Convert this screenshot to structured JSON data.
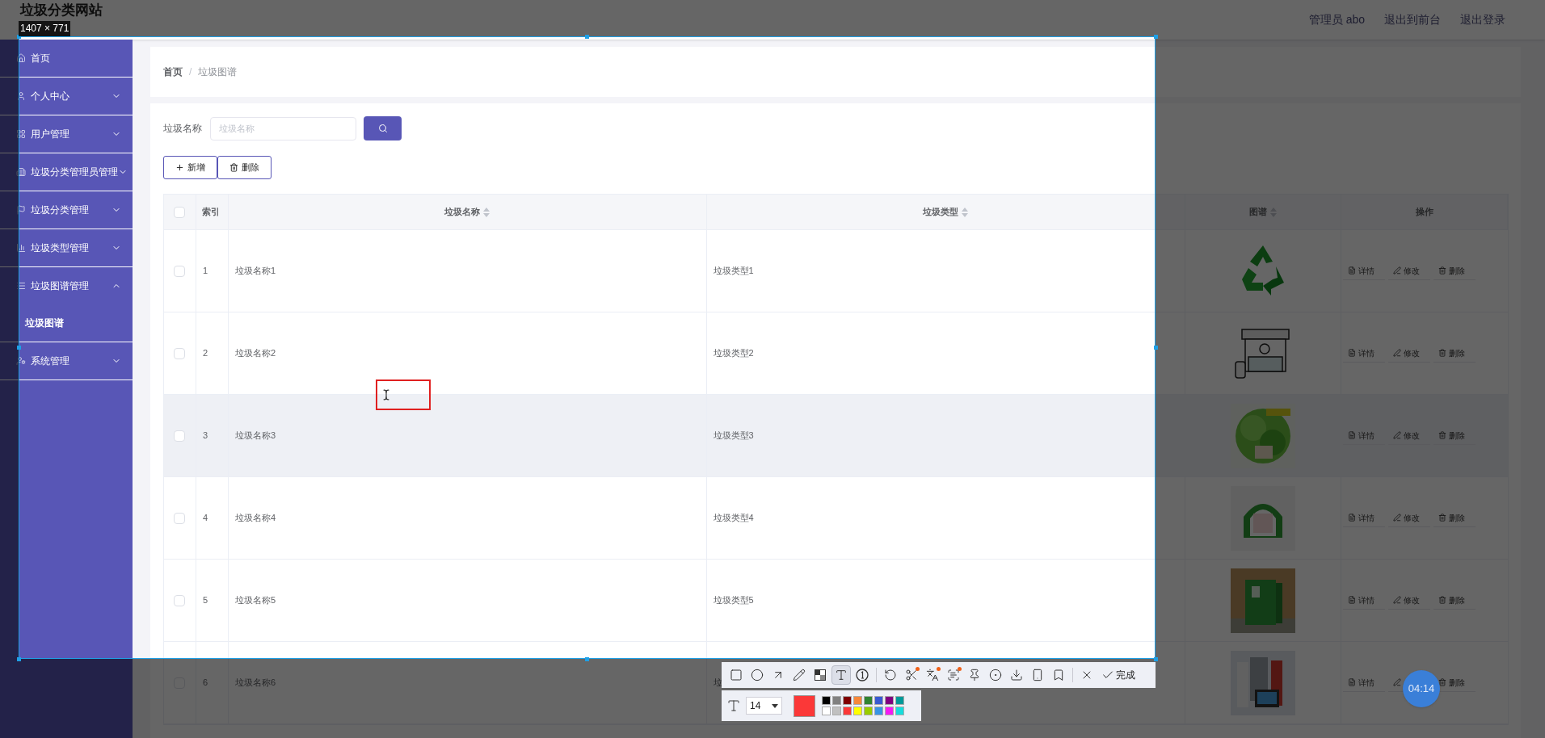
{
  "header": {
    "title": "垃圾分类网站",
    "user": "管理员 abo",
    "links": [
      "退出到前台",
      "退出登录"
    ]
  },
  "sidebar": {
    "items": [
      {
        "label": "首页",
        "kind": "link"
      },
      {
        "label": "个人中心",
        "kind": "menu",
        "expanded": false
      },
      {
        "label": "用户管理",
        "kind": "menu",
        "expanded": false
      },
      {
        "label": "垃圾分类管理员管理",
        "kind": "menu",
        "expanded": false
      },
      {
        "label": "垃圾分类管理",
        "kind": "menu",
        "expanded": false
      },
      {
        "label": "垃圾类型管理",
        "kind": "menu",
        "expanded": false
      },
      {
        "label": "垃圾图谱管理",
        "kind": "menu",
        "expanded": true,
        "children": [
          {
            "label": "垃圾图谱"
          }
        ]
      },
      {
        "label": "系统管理",
        "kind": "menu",
        "expanded": false
      }
    ]
  },
  "breadcrumb": {
    "items": [
      "首页",
      "垃圾图谱"
    ],
    "separator": "/"
  },
  "search": {
    "label": "垃圾名称",
    "placeholder": "垃圾名称"
  },
  "buttons": [
    {
      "kind": "add",
      "label": "新增"
    },
    {
      "kind": "delete",
      "label": "删除"
    }
  ],
  "table": {
    "header_checked": false,
    "columns": [
      {
        "label": "索引",
        "sortable": false
      },
      {
        "label": "垃圾名称",
        "sortable": true
      },
      {
        "label": "垃圾类型",
        "sortable": true
      },
      {
        "label": "图谱",
        "sortable": true
      },
      {
        "label": "操作",
        "sortable": false
      }
    ],
    "rows": [
      {
        "checked": false,
        "hovered": false,
        "index": "1",
        "name": "垃圾名称1",
        "type": "垃圾类型1",
        "actions": [
          {
            "kind": "detail",
            "label": "详情"
          },
          {
            "kind": "edit",
            "label": "修改"
          },
          {
            "kind": "delete",
            "label": "删除"
          }
        ]
      },
      {
        "checked": false,
        "hovered": false,
        "index": "2",
        "name": "垃圾名称2",
        "type": "垃圾类型2",
        "actions": [
          {
            "kind": "detail",
            "label": "详情"
          },
          {
            "kind": "edit",
            "label": "修改"
          },
          {
            "kind": "delete",
            "label": "删除"
          }
        ]
      },
      {
        "checked": false,
        "hovered": true,
        "index": "3",
        "name": "垃圾名称3",
        "type": "垃圾类型3",
        "actions": [
          {
            "kind": "detail",
            "label": "详情"
          },
          {
            "kind": "edit",
            "label": "修改"
          },
          {
            "kind": "delete",
            "label": "删除"
          }
        ]
      },
      {
        "checked": false,
        "hovered": false,
        "index": "4",
        "name": "垃圾名称4",
        "type": "垃圾类型4",
        "actions": [
          {
            "kind": "detail",
            "label": "详情"
          },
          {
            "kind": "edit",
            "label": "修改"
          },
          {
            "kind": "delete",
            "label": "删除"
          }
        ]
      },
      {
        "checked": false,
        "hovered": false,
        "index": "5",
        "name": "垃圾名称5",
        "type": "垃圾类型5",
        "actions": [
          {
            "kind": "detail",
            "label": "详情"
          },
          {
            "kind": "edit",
            "label": "修改"
          },
          {
            "kind": "delete",
            "label": "删除"
          }
        ]
      },
      {
        "checked": false,
        "hovered": false,
        "index": "6",
        "name": "垃圾名称6",
        "type": "垃",
        "actions": [
          {
            "kind": "detail",
            "label": "详情"
          },
          {
            "kind": "edit"
          },
          {
            "kind": "delete",
            "label": "删除"
          }
        ]
      }
    ]
  },
  "capture": {
    "size_label": "1407 × 771",
    "tool_groups": [
      [
        {
          "kind": "rect",
          "selected": false,
          "badge": false
        },
        {
          "kind": "ellipse",
          "selected": false,
          "badge": false
        },
        {
          "kind": "arrow",
          "selected": false,
          "badge": false
        },
        {
          "kind": "pen",
          "selected": false,
          "badge": false
        },
        {
          "kind": "mosaic",
          "selected": false,
          "badge": false
        },
        {
          "kind": "text",
          "selected": true,
          "badge": false
        },
        {
          "kind": "number",
          "selected": false,
          "badge": false
        }
      ],
      [
        {
          "kind": "undo",
          "selected": false,
          "badge": false
        },
        {
          "kind": "cut",
          "selected": false,
          "badge": true
        },
        {
          "kind": "translate",
          "selected": false,
          "badge": true
        },
        {
          "kind": "ocr",
          "selected": false,
          "badge": true
        },
        {
          "kind": "pin",
          "selected": false,
          "badge": false
        },
        {
          "kind": "record",
          "selected": false,
          "badge": false
        },
        {
          "kind": "save",
          "selected": false,
          "badge": false
        },
        {
          "kind": "phone",
          "selected": false,
          "badge": false
        },
        {
          "kind": "bookmark",
          "selected": false,
          "badge": false
        }
      ],
      [
        {
          "kind": "cancel",
          "selected": false,
          "badge": false
        }
      ]
    ],
    "done_label": "完成",
    "font_size": "14",
    "current": {
      "color": "#fb3838"
    },
    "palette": [
      {
        "color": "#000000"
      },
      {
        "color": "#808080"
      },
      {
        "color": "#800000"
      },
      {
        "color": "#f7883a"
      },
      {
        "color": "#308430"
      },
      {
        "color": "#385ad3"
      },
      {
        "color": "#800080"
      },
      {
        "color": "#009999"
      },
      {
        "color": "#ffffff"
      },
      {
        "color": "#c0c0c0"
      },
      {
        "color": "#fb3838"
      },
      {
        "color": "#ffff00"
      },
      {
        "color": "#99cc00"
      },
      {
        "color": "#3894e4"
      },
      {
        "color": "#f31bf3"
      },
      {
        "color": "#16dcdc"
      }
    ]
  },
  "timer": "04:14"
}
